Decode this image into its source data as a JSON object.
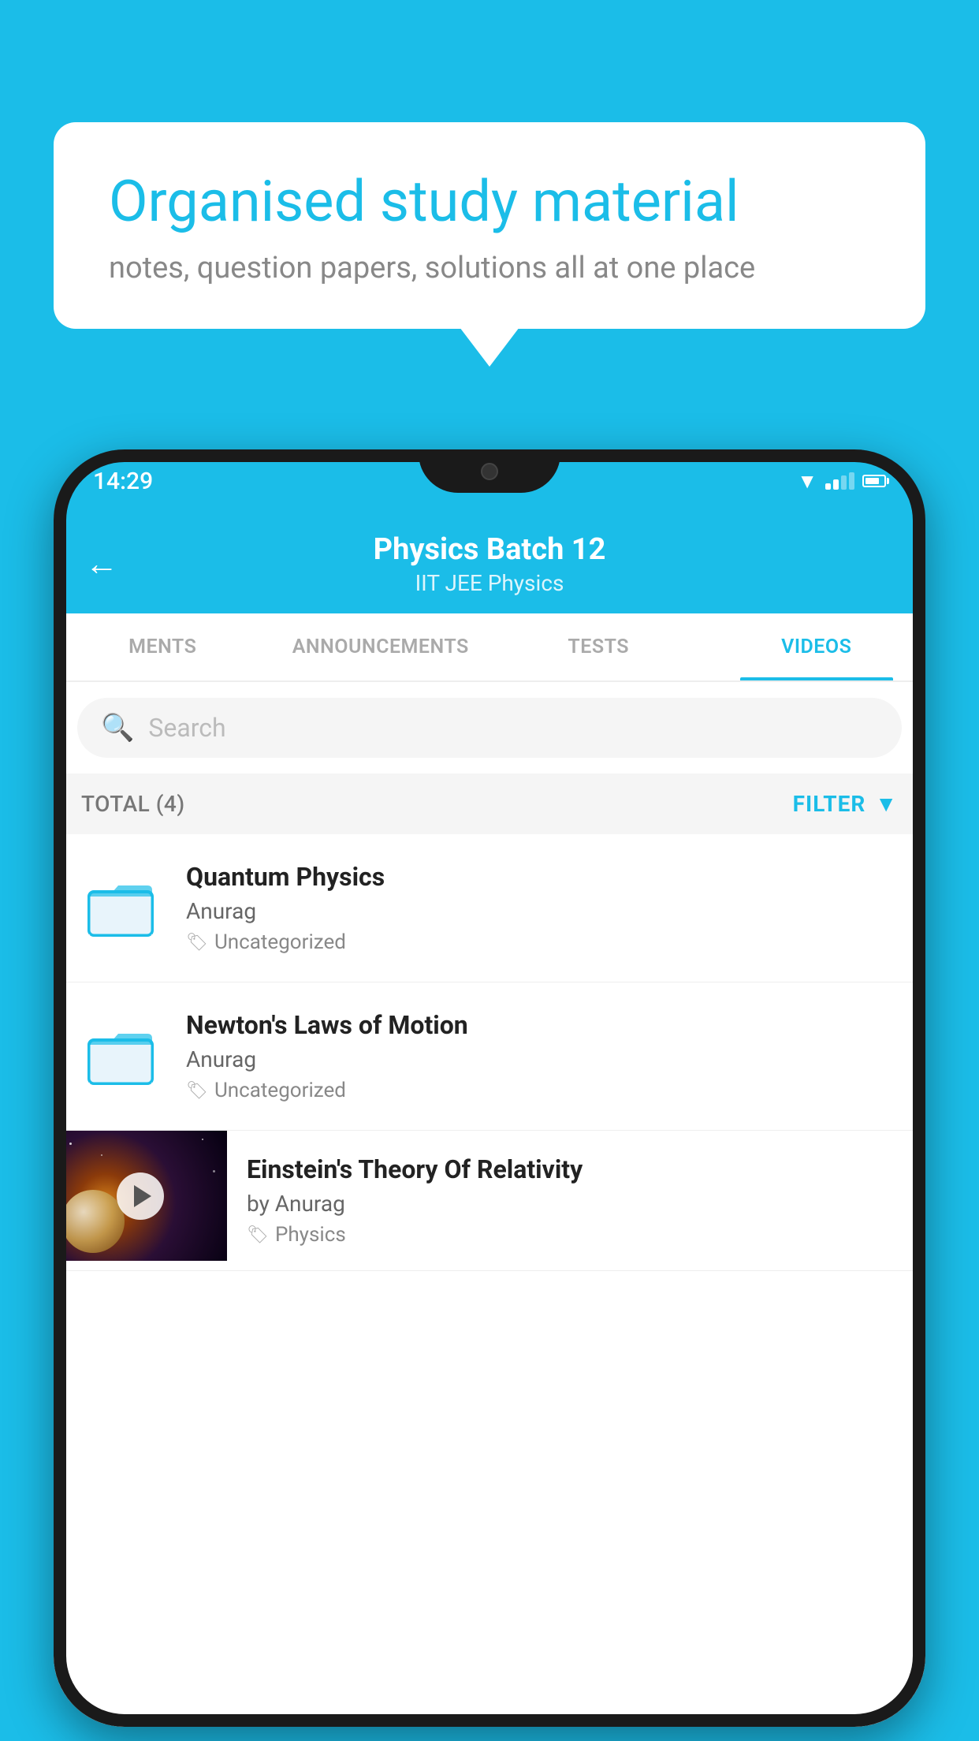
{
  "background": {
    "color": "#1BBDE8"
  },
  "bubble": {
    "title": "Organised study material",
    "subtitle": "notes, question papers, solutions all at one place"
  },
  "phone": {
    "status_bar": {
      "time": "14:29"
    },
    "header": {
      "title": "Physics Batch 12",
      "subtitle": "IIT JEE   Physics",
      "back_label": "←"
    },
    "tabs": [
      {
        "label": "MENTS",
        "active": false
      },
      {
        "label": "ANNOUNCEMENTS",
        "active": false
      },
      {
        "label": "TESTS",
        "active": false
      },
      {
        "label": "VIDEOS",
        "active": true
      }
    ],
    "search": {
      "placeholder": "Search"
    },
    "filter_bar": {
      "total_label": "TOTAL (4)",
      "filter_label": "FILTER"
    },
    "videos": [
      {
        "title": "Quantum Physics",
        "author": "Anurag",
        "tag": "Uncategorized",
        "type": "folder"
      },
      {
        "title": "Newton's Laws of Motion",
        "author": "Anurag",
        "tag": "Uncategorized",
        "type": "folder"
      },
      {
        "title": "Einstein's Theory Of Relativity",
        "author": "by Anurag",
        "tag": "Physics",
        "type": "video"
      }
    ]
  }
}
